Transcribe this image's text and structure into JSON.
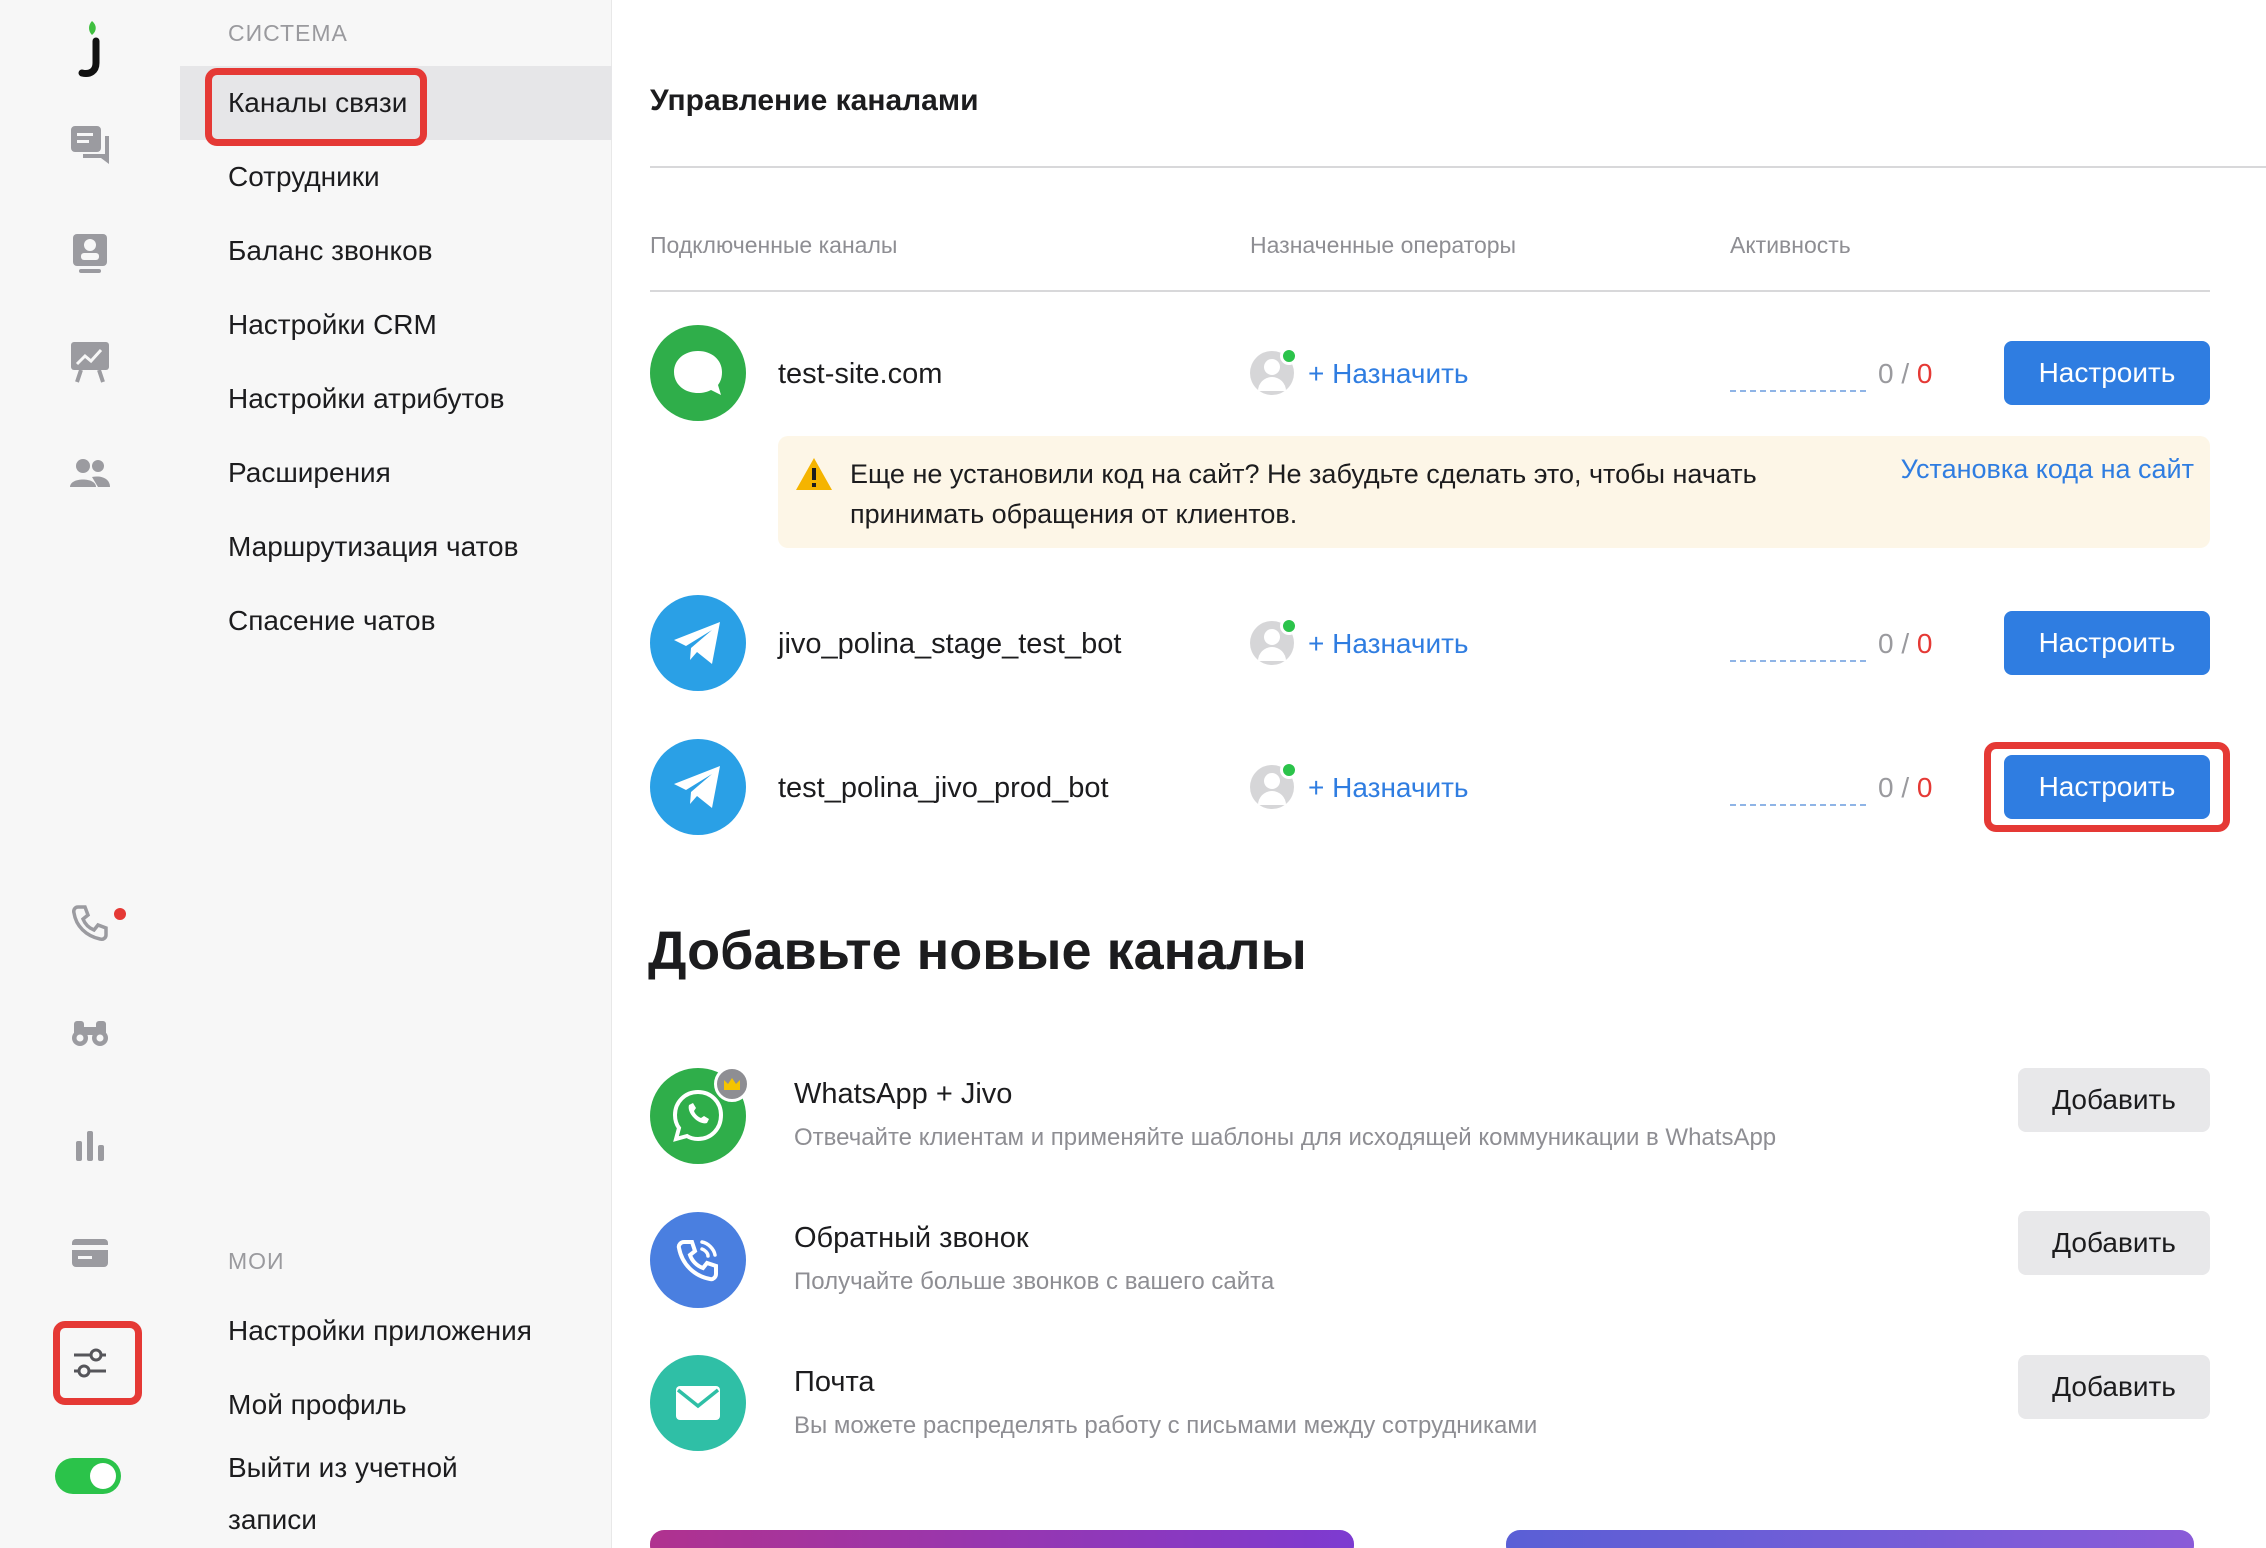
{
  "rail": {
    "logo": "j",
    "icons": [
      "chat-icon",
      "contacts-icon",
      "presentation-icon",
      "team-icon",
      "phone-icon",
      "binoculars-icon",
      "analytics-icon",
      "billing-icon",
      "settings-sliders-icon"
    ],
    "toggle_on": true,
    "colors": {
      "badge": "#e53935",
      "toggle": "#2bc34a",
      "highlight": "#e53935"
    }
  },
  "sidebar": {
    "section_system": "СИСТЕМА",
    "system_items": [
      "Каналы связи",
      "Сотрудники",
      "Баланс звонков",
      "Настройки CRM",
      "Настройки атрибутов",
      "Расширения",
      "Маршрутизация чатов",
      "Спасение чатов"
    ],
    "section_mine": "МОИ",
    "mine_items": [
      "Настройки приложения",
      "Мой профиль",
      "Выйти из учетной",
      "записи"
    ]
  },
  "main": {
    "title": "Управление каналами",
    "columns": {
      "channels": "Подключенные каналы",
      "operators": "Назначенные операторы",
      "activity": "Активность"
    },
    "channels": [
      {
        "name": "test-site.com",
        "icon": "chat-bubble-icon",
        "assign": "+ Назначить",
        "count_a": "0",
        "sep": "/",
        "count_b": "0",
        "button": "Настроить"
      },
      {
        "name": "jivo_polina_stage_test_bot",
        "icon": "telegram-icon",
        "assign": "+ Назначить",
        "count_a": "0",
        "sep": "/",
        "count_b": "0",
        "button": "Настроить"
      },
      {
        "name": "test_polina_jivo_prod_bot",
        "icon": "telegram-icon",
        "assign": "+ Назначить",
        "count_a": "0",
        "sep": "/",
        "count_b": "0",
        "button": "Настроить"
      }
    ],
    "warning": {
      "text_line1": "Еще не установили код на сайт? Не забудьте сделать это, чтобы начать",
      "text_line2": "принимать обращения от клиентов.",
      "link": "Установка кода на сайт"
    },
    "add_title": "Добавьте новые каналы",
    "add_channels": [
      {
        "title": "WhatsApp + Jivo",
        "desc": "Отвечайте клиентам и применяйте шаблоны для исходящей коммуникации в WhatsApp",
        "button": "Добавить",
        "icon": "whatsapp-icon"
      },
      {
        "title": "Обратный звонок",
        "desc": "Получайте больше звонков с вашего сайта",
        "button": "Добавить",
        "icon": "callback-icon"
      },
      {
        "title": "Почта",
        "desc": "Вы можете распределять работу с письмами между сотрудниками",
        "button": "Добавить",
        "icon": "mail-icon"
      }
    ],
    "colors": {
      "primary": "#2f7de1",
      "counter_red": "#e53935",
      "warning_bg": "#fdf6e7"
    }
  }
}
